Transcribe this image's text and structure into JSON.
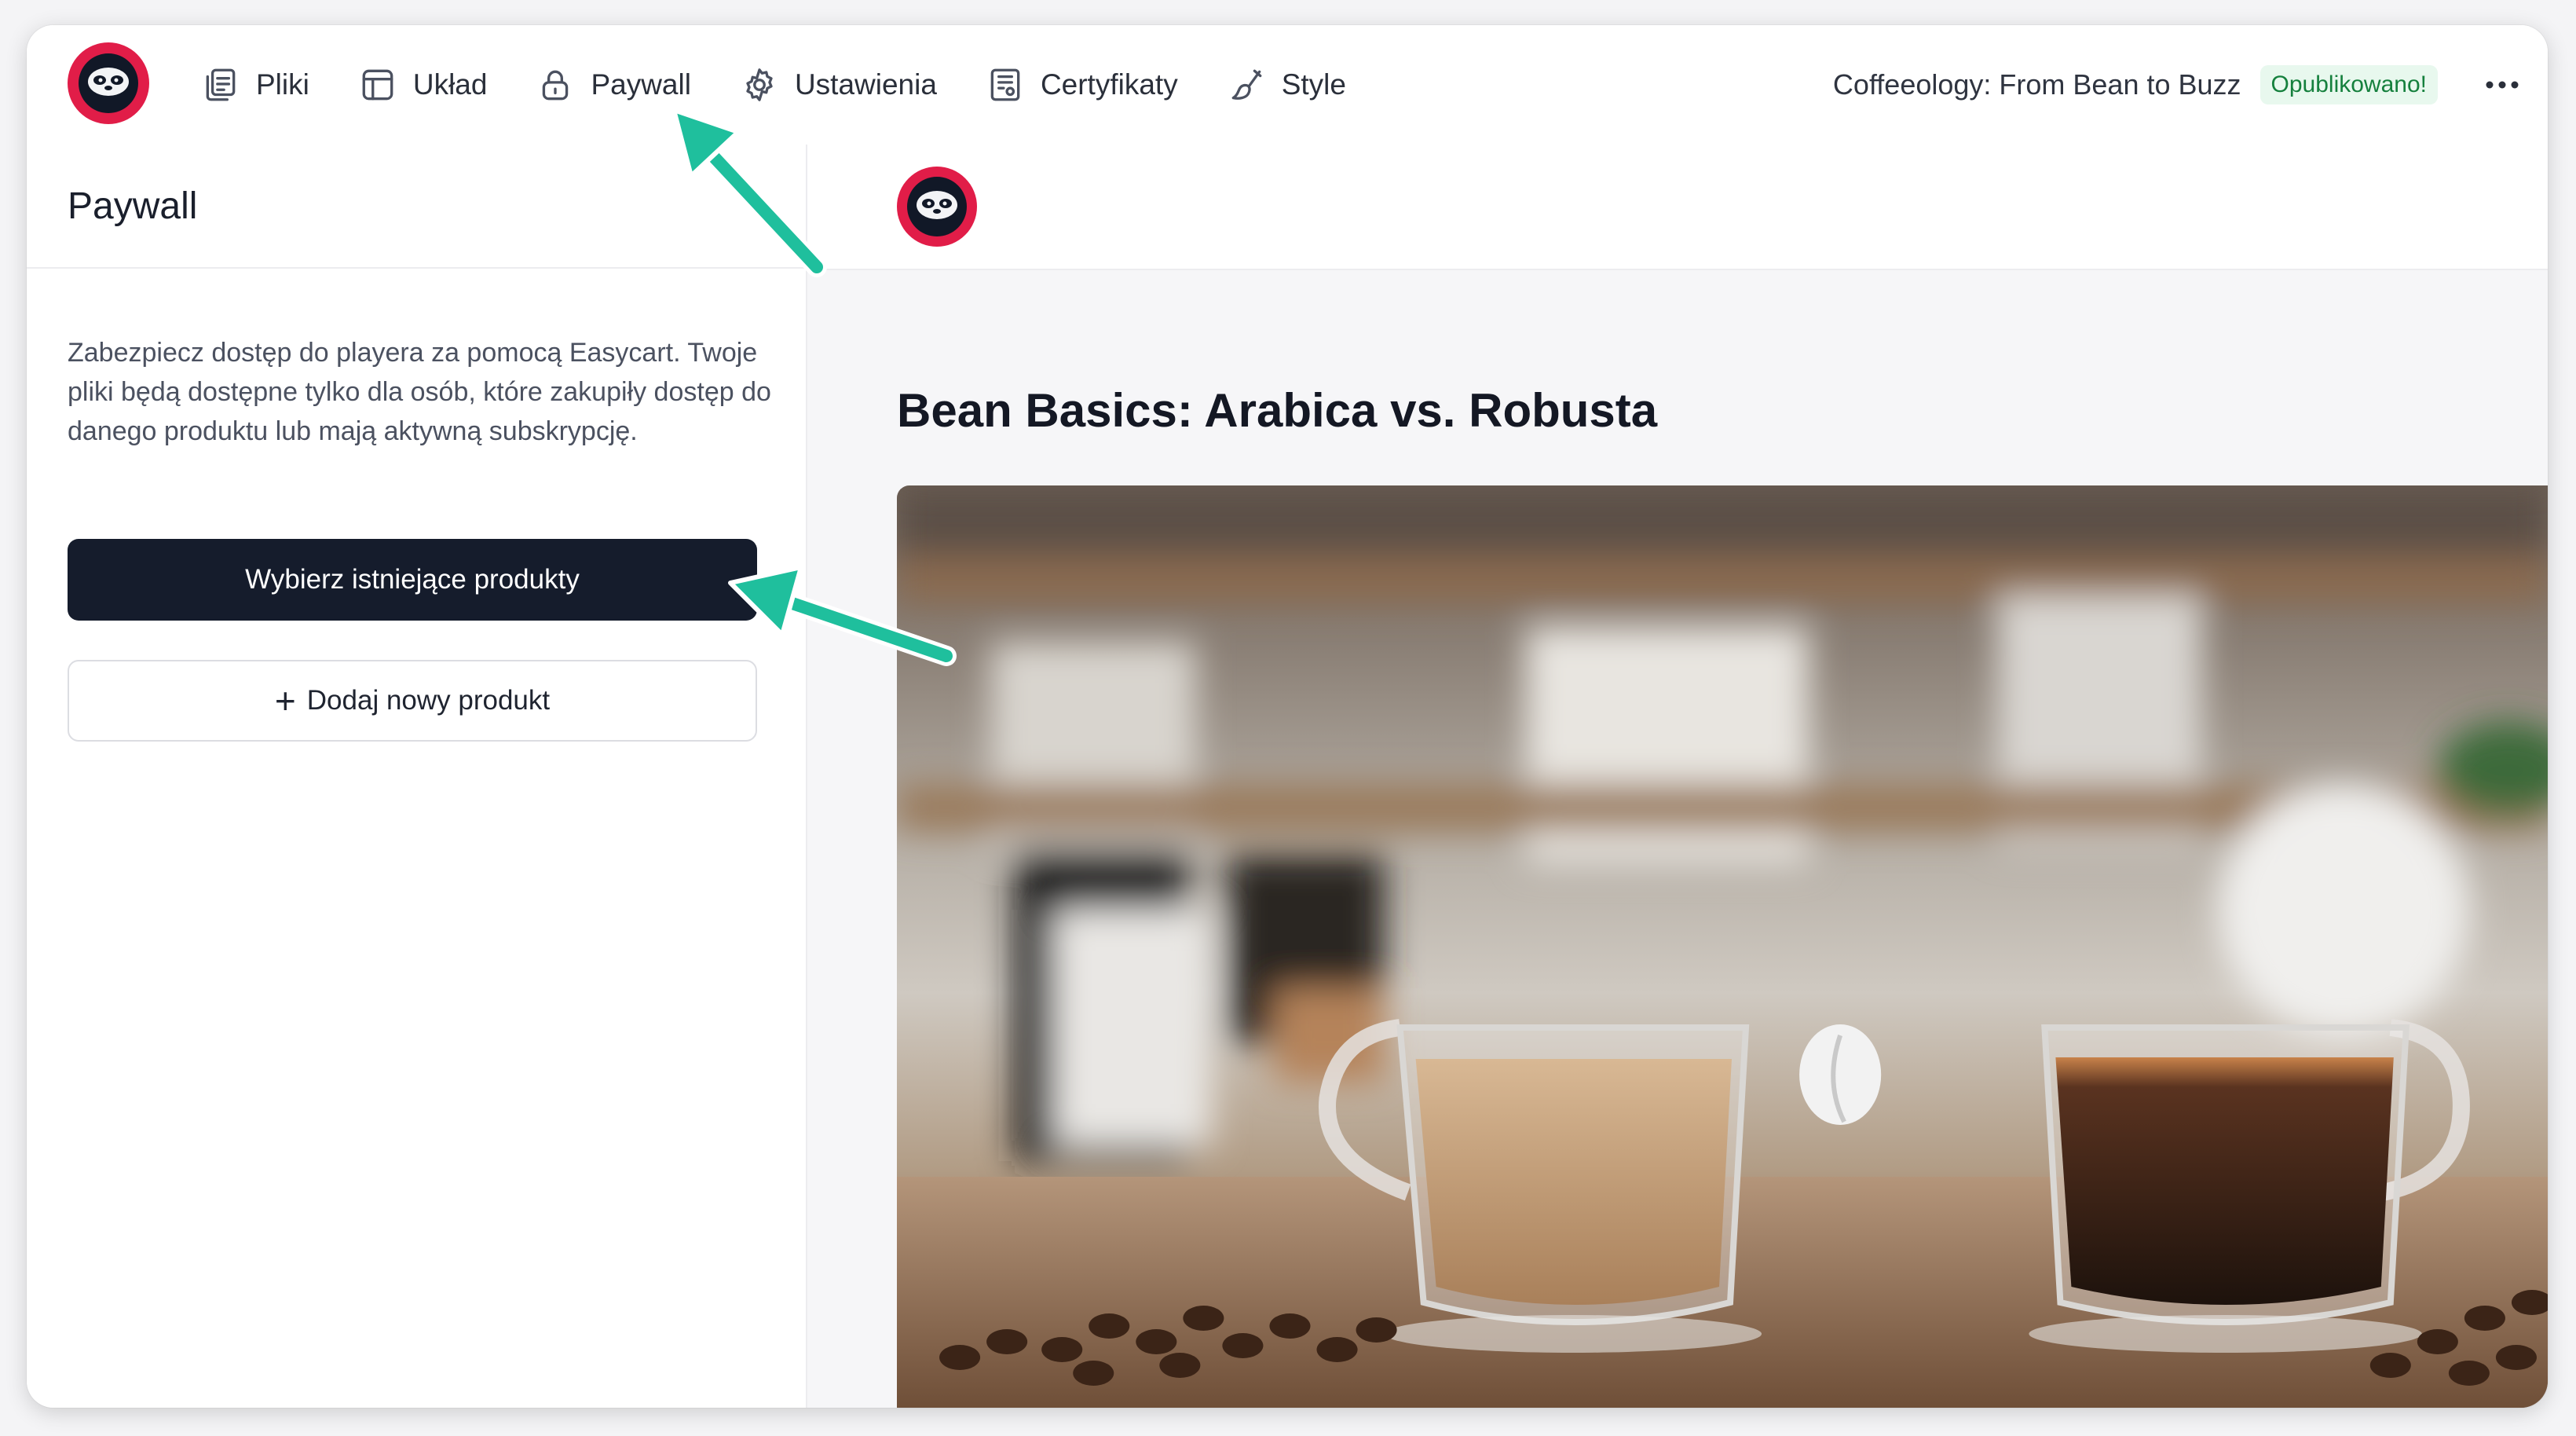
{
  "nav": {
    "items": [
      {
        "id": "pliki",
        "label": "Pliki",
        "icon": "files-icon"
      },
      {
        "id": "uklad",
        "label": "Układ",
        "icon": "layout-icon"
      },
      {
        "id": "paywall",
        "label": "Paywall",
        "icon": "lock-icon"
      },
      {
        "id": "ustawienia",
        "label": "Ustawienia",
        "icon": "gear-icon"
      },
      {
        "id": "certyfikaty",
        "label": "Certyfikaty",
        "icon": "certificate-icon"
      },
      {
        "id": "style",
        "label": "Style",
        "icon": "brush-icon"
      }
    ]
  },
  "header": {
    "course_title": "Coffeeology: From Bean to Buzz",
    "status_badge": "Opublikowano!",
    "more_icon": "more-horizontal-icon"
  },
  "panel": {
    "title": "Paywall",
    "description": "Zabezpiecz dostęp do playera za pomocą Easycart. Twoje pliki będą dostępne tylko dla osób, które zakupiły dostęp do danego produktu lub mają aktywną subskrypcję.",
    "primary_button": "Wybierz istniejące produkty",
    "secondary_button": "Dodaj nowy produkt"
  },
  "preview": {
    "lesson_title": "Bean Basics: Arabica vs. Robusta"
  },
  "colors": {
    "brand_red": "#e11d48",
    "dark": "#151c2c",
    "badge_bg": "#e8f8ee",
    "badge_text": "#15803d",
    "annotation_arrow": "#1fbf9d"
  }
}
